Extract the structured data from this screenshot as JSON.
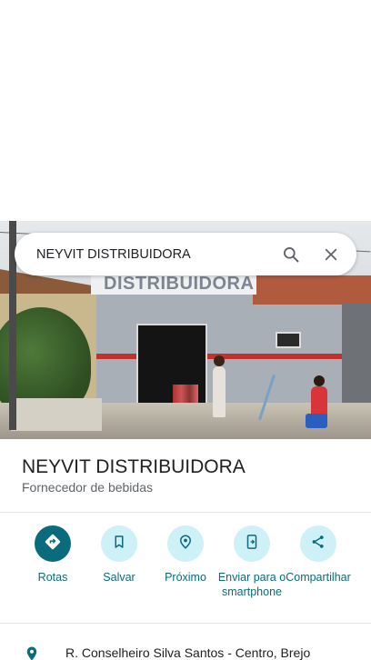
{
  "search": {
    "query": "NEYVIT DISTRIBUIDORA"
  },
  "photo": {
    "sign_text": "DISTRIBUIDORA"
  },
  "place": {
    "title": "NEYVIT DISTRIBUIDORA",
    "category": "Fornecedor de bebidas"
  },
  "actions": [
    {
      "label": "Rotas",
      "icon": "directions-icon"
    },
    {
      "label": "Salvar",
      "icon": "bookmark-icon"
    },
    {
      "label": "Próximo",
      "icon": "nearby-icon"
    },
    {
      "label": "Enviar para o smartphone",
      "icon": "send-to-phone-icon"
    },
    {
      "label": "Compartilhar",
      "icon": "share-icon"
    }
  ],
  "address": {
    "text": "R. Conselheiro Silva Santos - Centro, Brejo"
  },
  "colors": {
    "accent": "#0a6b7d",
    "accent_light": "#cef0f7",
    "text_primary": "#202124",
    "text_secondary": "#5f6368"
  }
}
